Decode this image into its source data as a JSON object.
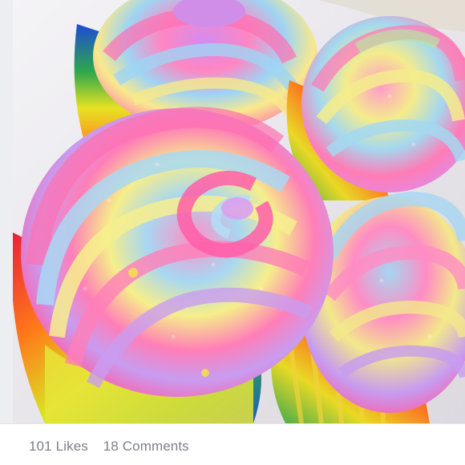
{
  "post": {
    "likes": {
      "count": "101",
      "label": "Likes"
    },
    "comments": {
      "count": "18",
      "label": "Comments"
    }
  },
  "colors": {
    "stats_text": "#7c808a",
    "footer_bg": "#ffffff",
    "side_strip": "#eceef1"
  }
}
